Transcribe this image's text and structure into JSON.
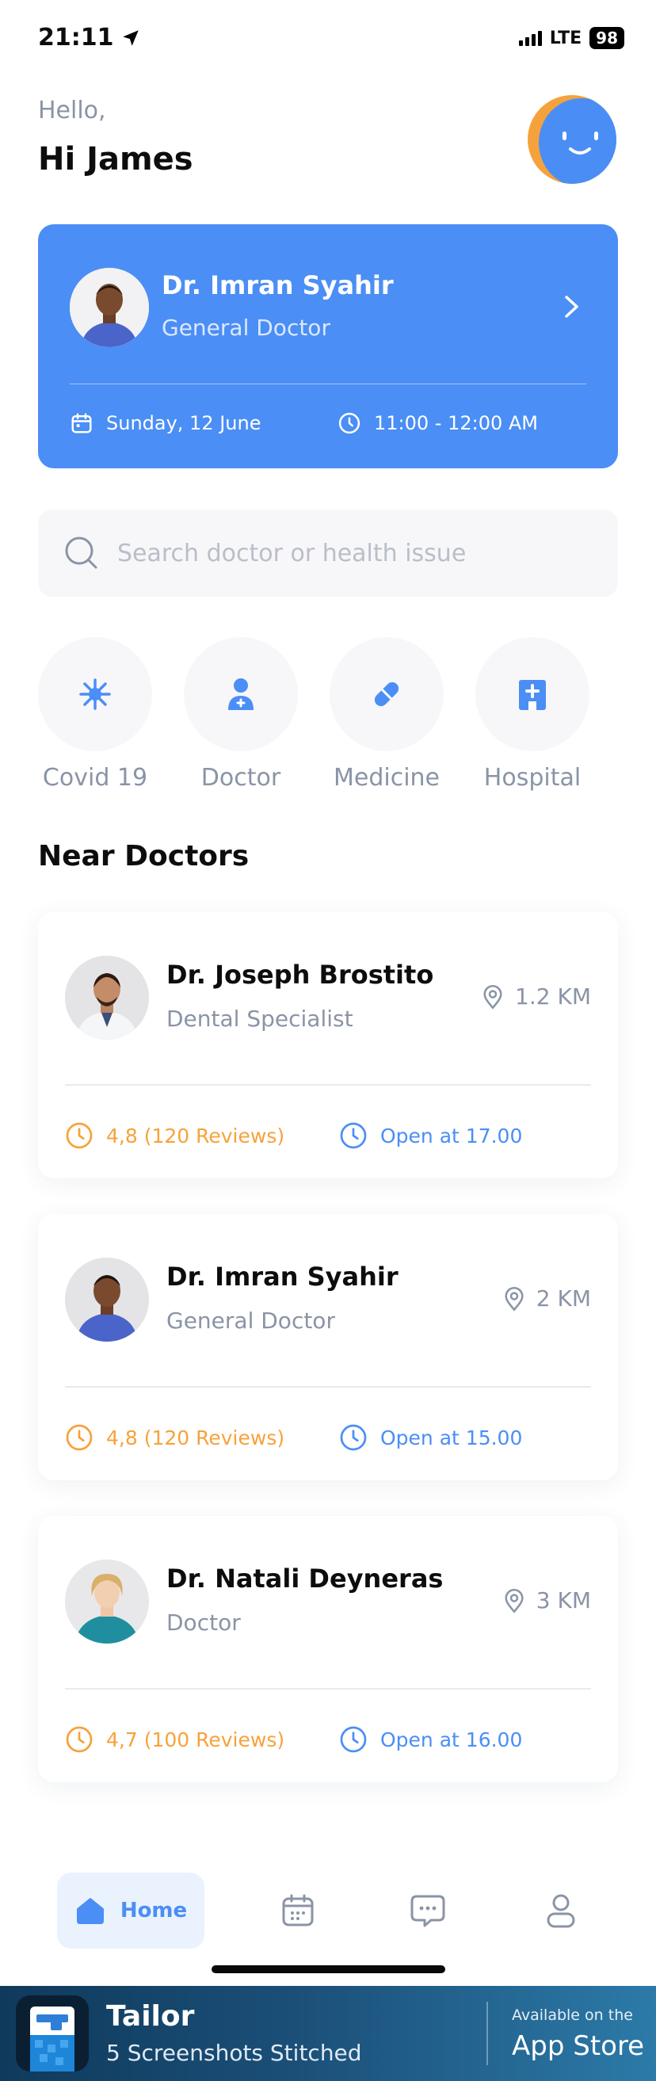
{
  "status_bar": {
    "time": "21:11",
    "network": "LTE",
    "battery": "98"
  },
  "greeting": {
    "hello": "Hello,",
    "name": "Hi James"
  },
  "appointment": {
    "doctor_name": "Dr. Imran Syahir",
    "specialty": "General Doctor",
    "date": "Sunday, 12 June",
    "time": "11:00 - 12:00 AM"
  },
  "search": {
    "placeholder": "Search doctor or health issue"
  },
  "categories": [
    {
      "label": "Covid 19",
      "icon": "virus-icon"
    },
    {
      "label": "Doctor",
      "icon": "doctor-icon"
    },
    {
      "label": "Medicine",
      "icon": "pill-icon"
    },
    {
      "label": "Hospital",
      "icon": "hospital-icon"
    }
  ],
  "near_doctors": {
    "title": "Near Doctors",
    "items": [
      {
        "name": "Dr. Joseph Brostito",
        "specialty": "Dental Specialist",
        "distance": "1.2 KM",
        "rating": "4,8 (120 Reviews)",
        "open": "Open at 17.00"
      },
      {
        "name": "Dr. Imran Syahir",
        "specialty": "General Doctor",
        "distance": "2 KM",
        "rating": "4,8 (120 Reviews)",
        "open": "Open at 15.00"
      },
      {
        "name": "Dr. Natali Deyneras",
        "specialty": "Doctor",
        "distance": "3 KM",
        "rating": "4,7 (100 Reviews)",
        "open": "Open at 16.00"
      }
    ]
  },
  "bottom_nav": {
    "home": "Home"
  },
  "banner": {
    "title": "Tailor",
    "subtitle": "5 Screenshots Stitched",
    "available": "Available on the",
    "store": "App Store"
  },
  "colors": {
    "primary": "#4b8ef5",
    "rating": "#f7a23a",
    "muted": "#8a94a6"
  }
}
